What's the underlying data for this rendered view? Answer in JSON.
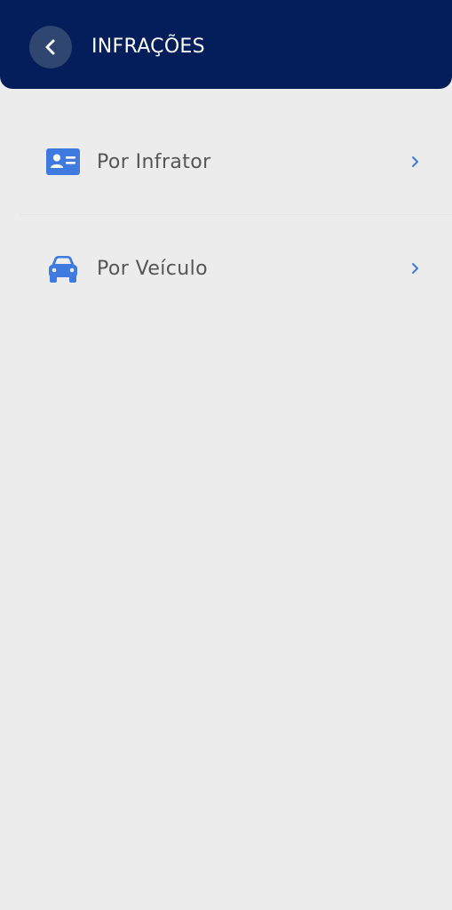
{
  "header": {
    "title": "INFRAÇÕES",
    "back_icon": "chevron-left-icon",
    "background_color": "#041e5c"
  },
  "menu": {
    "items": [
      {
        "label": "Por Infrator",
        "icon": "id-card-icon",
        "trailing_icon": "chevron-right-icon"
      },
      {
        "label": "Por Veículo",
        "icon": "car-icon",
        "trailing_icon": "chevron-right-icon"
      }
    ]
  },
  "colors": {
    "accent": "#3f7ae0",
    "background": "#ececec",
    "text": "#555555"
  }
}
